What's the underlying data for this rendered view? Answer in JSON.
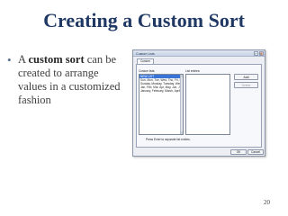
{
  "slide": {
    "title": "Creating a Custom Sort",
    "bullet_prefix": "A ",
    "bullet_bold": "custom sort",
    "bullet_rest": " can be created to arrange values in a customized fashion",
    "page_number": "20"
  },
  "dialog": {
    "title": "Custom Lists",
    "tab_label": "Custom Lists",
    "custom_lists_label": "Custom lists:",
    "list_entries_label": "List entries:",
    "custom_lists": [
      "NEW LIST",
      "Sun, Mon, Tue, Wed, Thu, Fri, S",
      "Sunday, Monday, Tuesday, Wec",
      "Jan, Feb, Mar, Apr, May, Jun, J",
      "January, February, March, April"
    ],
    "selected_index": 0,
    "add_label": "Add",
    "delete_label": "Delete",
    "hint": "Press Enter to separate list entries.",
    "ok_label": "OK",
    "cancel_label": "Cancel",
    "help_glyph": "?",
    "close_glyph": "✕"
  }
}
